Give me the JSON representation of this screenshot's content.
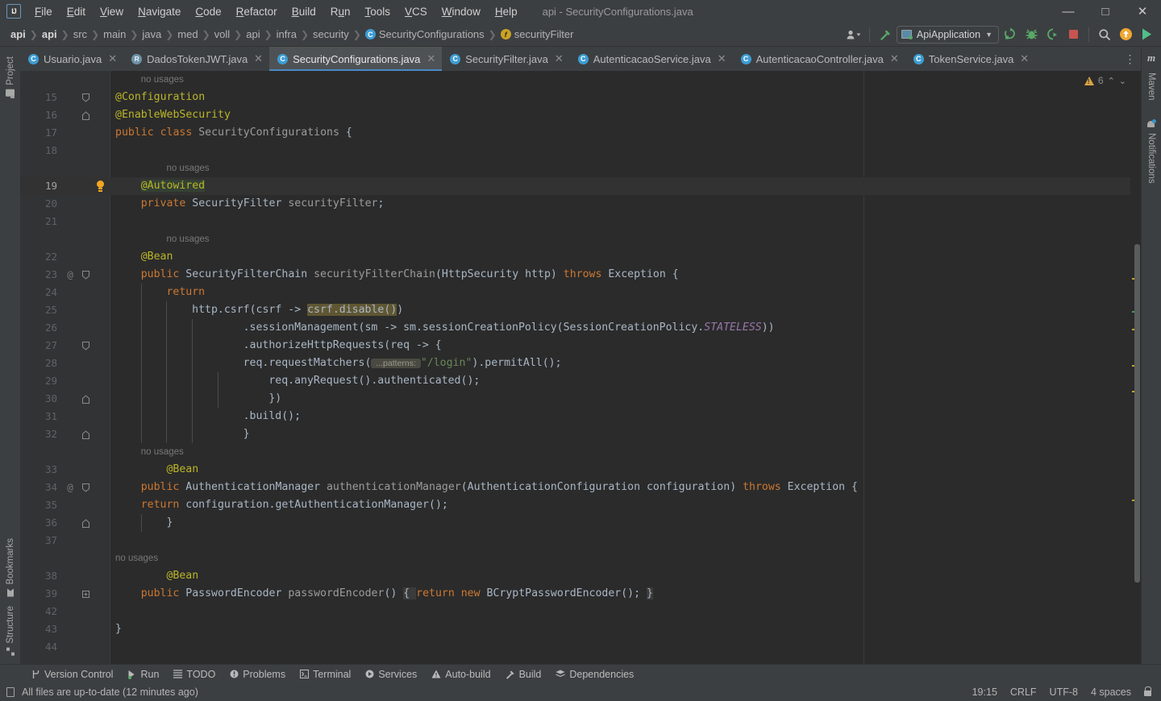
{
  "window": {
    "title": "api - SecurityConfigurations.java",
    "app_icon": "intellij-logo-icon",
    "minimize": "—",
    "maximize": "□",
    "close": "✕"
  },
  "menubar": [
    {
      "label": "File"
    },
    {
      "label": "Edit"
    },
    {
      "label": "View"
    },
    {
      "label": "Navigate"
    },
    {
      "label": "Code"
    },
    {
      "label": "Refactor"
    },
    {
      "label": "Build"
    },
    {
      "label": "Run"
    },
    {
      "label": "Tools"
    },
    {
      "label": "VCS"
    },
    {
      "label": "Window"
    },
    {
      "label": "Help"
    }
  ],
  "breadcrumbs": [
    {
      "label": "api",
      "icon": "",
      "bold": true
    },
    {
      "label": "api",
      "icon": "",
      "bold": true
    },
    {
      "label": "src",
      "icon": ""
    },
    {
      "label": "main",
      "icon": ""
    },
    {
      "label": "java",
      "icon": ""
    },
    {
      "label": "med",
      "icon": ""
    },
    {
      "label": "voll",
      "icon": ""
    },
    {
      "label": "api",
      "icon": ""
    },
    {
      "label": "infra",
      "icon": ""
    },
    {
      "label": "security",
      "icon": ""
    },
    {
      "label": "SecurityConfigurations",
      "icon": "class-icon",
      "icon_glyph": "C"
    },
    {
      "label": "securityFilter",
      "icon": "field-icon",
      "icon_glyph": "f"
    }
  ],
  "toolbar": {
    "run_configuration": "ApiApplication",
    "buttons": [
      {
        "name": "user-account-icon"
      },
      {
        "name": "build-hammer-icon"
      },
      {
        "name": "run-icon"
      },
      {
        "name": "debug-icon"
      },
      {
        "name": "run-with-coverage-icon"
      },
      {
        "name": "stop-icon"
      },
      {
        "name": "search-everywhere-icon"
      },
      {
        "name": "update-project-icon"
      },
      {
        "name": "ide-assistant-icon"
      }
    ]
  },
  "left_stripe": [
    {
      "label": "Project",
      "icon": "folder-icon"
    },
    {
      "label": "Bookmarks",
      "icon": "bookmark-icon"
    },
    {
      "label": "Structure",
      "icon": "structure-icon"
    }
  ],
  "right_stripe": [
    {
      "label": "Maven",
      "icon": "maven-icon"
    },
    {
      "label": "Notifications",
      "icon": "bell-icon"
    }
  ],
  "tabs": [
    {
      "label": "Usuario.java",
      "icon": "class-icon",
      "glyph": "C",
      "active": false
    },
    {
      "label": "DadosTokenJWT.java",
      "icon": "record-icon",
      "glyph": "R",
      "active": false
    },
    {
      "label": "SecurityConfigurations.java",
      "icon": "class-icon",
      "glyph": "C",
      "active": true
    },
    {
      "label": "SecurityFilter.java",
      "icon": "class-icon",
      "glyph": "C",
      "active": false
    },
    {
      "label": "AutenticacaoService.java",
      "icon": "class-icon",
      "glyph": "C",
      "active": false
    },
    {
      "label": "AutenticacaoController.java",
      "icon": "class-icon",
      "glyph": "C",
      "active": false
    },
    {
      "label": "TokenService.java",
      "icon": "class-icon",
      "glyph": "C",
      "active": false
    }
  ],
  "inspection_widget": {
    "warning_count": "6",
    "icon": "warning-triangle-icon",
    "prev": "⌃",
    "next": "⌄"
  },
  "editor": {
    "file": "SecurityConfigurations.java",
    "lines": [
      {
        "num": "",
        "kind": "hint",
        "text": "no usages",
        "indent": 0
      },
      {
        "num": "15",
        "kind": "code",
        "fold": "collapse-top",
        "tokens": [
          {
            "t": "@Configuration",
            "c": "ann"
          }
        ]
      },
      {
        "num": "16",
        "kind": "code",
        "fold": "collapse-bottom",
        "tokens": [
          {
            "t": "@EnableWebSecurity",
            "c": "ann"
          }
        ]
      },
      {
        "num": "17",
        "kind": "code",
        "tokens": [
          {
            "t": "public ",
            "c": "kw"
          },
          {
            "t": "class ",
            "c": "kw"
          },
          {
            "t": "SecurityConfigurations ",
            "c": "decl"
          },
          {
            "t": "{",
            "c": "punc"
          }
        ]
      },
      {
        "num": "18",
        "kind": "code",
        "tokens": []
      },
      {
        "num": "",
        "kind": "hint",
        "text": "no usages",
        "indent": 1
      },
      {
        "num": "19",
        "kind": "code",
        "bulb": true,
        "highlight": true,
        "tokens": [
          {
            "t": "@Autowired",
            "c": "ann sel"
          }
        ]
      },
      {
        "num": "20",
        "kind": "code",
        "tokens": [
          {
            "t": "private ",
            "c": "kw"
          },
          {
            "t": "SecurityFilter ",
            "c": "cls"
          },
          {
            "t": "securityFilter",
            "c": "decl"
          },
          {
            "t": ";",
            "c": "punc"
          }
        ]
      },
      {
        "num": "21",
        "kind": "code",
        "tokens": []
      },
      {
        "num": "",
        "kind": "hint",
        "text": "no usages",
        "indent": 1
      },
      {
        "num": "22",
        "kind": "code",
        "tokens": [
          {
            "t": "@Bean",
            "c": "ann"
          }
        ]
      },
      {
        "num": "23",
        "kind": "code",
        "annot": "@",
        "fold": "collapse-top",
        "tokens": [
          {
            "t": "public ",
            "c": "kw"
          },
          {
            "t": "SecurityFilterChain ",
            "c": "cls"
          },
          {
            "t": "securityFilterChain",
            "c": "decl"
          },
          {
            "t": "(",
            "c": "punc"
          },
          {
            "t": "HttpSecurity http",
            "c": "cls"
          },
          {
            "t": ") ",
            "c": "punc"
          },
          {
            "t": "throws ",
            "c": "kw"
          },
          {
            "t": "Exception {",
            "c": "cls"
          }
        ]
      },
      {
        "num": "24",
        "kind": "code",
        "tokens": [
          {
            "t": "return",
            "c": "kw"
          }
        ]
      },
      {
        "num": "25",
        "kind": "code",
        "tokens": [
          {
            "t": "http.csrf(csrf -> ",
            "c": "punc"
          },
          {
            "t": "csrf.disable()",
            "c": "occ"
          },
          {
            "t": ")",
            "c": "punc"
          }
        ]
      },
      {
        "num": "26",
        "kind": "code",
        "tokens": [
          {
            "t": ".sessionManagement(sm -> sm.sessionCreationPolicy(SessionCreationPolicy.",
            "c": "punc"
          },
          {
            "t": "STATELESS",
            "c": "stat"
          },
          {
            "t": "))",
            "c": "punc"
          }
        ]
      },
      {
        "num": "27",
        "kind": "code",
        "fold": "collapse-top",
        "tokens": [
          {
            "t": ".authorizeHttpRequests(req -> {",
            "c": "punc"
          }
        ]
      },
      {
        "num": "28",
        "kind": "code",
        "tokens": [
          {
            "t": "req.requestMatchers(",
            "c": "punc"
          },
          {
            "t": " ...patterns: ",
            "c": "inlay"
          },
          {
            "t": "\"/login\"",
            "c": "str"
          },
          {
            "t": ").permitAll();",
            "c": "punc"
          }
        ]
      },
      {
        "num": "29",
        "kind": "code",
        "tokens": [
          {
            "t": "req.anyRequest().authenticated();",
            "c": "punc"
          }
        ]
      },
      {
        "num": "30",
        "kind": "code",
        "fold": "collapse-bottom",
        "tokens": [
          {
            "t": "})",
            "c": "punc"
          }
        ]
      },
      {
        "num": "31",
        "kind": "code",
        "tokens": [
          {
            "t": ".build();",
            "c": "punc"
          }
        ]
      },
      {
        "num": "32",
        "kind": "code",
        "fold": "collapse-bottom",
        "tokens": [
          {
            "t": "}",
            "c": "punc"
          }
        ]
      },
      {
        "num": "",
        "kind": "hint",
        "text": "no usages",
        "indent": 1
      },
      {
        "num": "33",
        "kind": "code",
        "tokens": [
          {
            "t": "@Bean",
            "c": "ann"
          }
        ]
      },
      {
        "num": "34",
        "kind": "code",
        "annot": "@",
        "fold": "collapse-top",
        "tokens": [
          {
            "t": "public ",
            "c": "kw"
          },
          {
            "t": "AuthenticationManager ",
            "c": "cls"
          },
          {
            "t": "authenticationManager",
            "c": "decl"
          },
          {
            "t": "(",
            "c": "punc"
          },
          {
            "t": "AuthenticationConfiguration configuration",
            "c": "cls"
          },
          {
            "t": ") ",
            "c": "punc"
          },
          {
            "t": "throws ",
            "c": "kw"
          },
          {
            "t": "Exception {",
            "c": "cls"
          }
        ]
      },
      {
        "num": "35",
        "kind": "code",
        "tokens": [
          {
            "t": "return ",
            "c": "kw"
          },
          {
            "t": "configuration.getAuthenticationManager();",
            "c": "punc"
          }
        ]
      },
      {
        "num": "36",
        "kind": "code",
        "fold": "collapse-bottom",
        "tokens": [
          {
            "t": "}",
            "c": "punc"
          }
        ]
      },
      {
        "num": "37",
        "kind": "code",
        "tokens": []
      },
      {
        "num": "",
        "kind": "hint",
        "text": "no usages",
        "indent": 1
      },
      {
        "num": "38",
        "kind": "code",
        "tokens": [
          {
            "t": "@Bean",
            "c": "ann"
          }
        ]
      },
      {
        "num": "39",
        "kind": "code",
        "fold": "expand",
        "tokens": [
          {
            "t": "public ",
            "c": "kw"
          },
          {
            "t": "PasswordEncoder ",
            "c": "cls"
          },
          {
            "t": "passwordEncoder",
            "c": "decl"
          },
          {
            "t": "() ",
            "c": "punc"
          },
          {
            "t": "{ ",
            "c": "foldbg"
          },
          {
            "t": "return ",
            "c": "kw"
          },
          {
            "t": "new ",
            "c": "kw"
          },
          {
            "t": "BCryptPasswordEncoder(); ",
            "c": "punc"
          },
          {
            "t": "}",
            "c": "foldbg"
          }
        ]
      },
      {
        "num": "42",
        "kind": "code",
        "tokens": []
      },
      {
        "num": "43",
        "kind": "code",
        "tokens": [
          {
            "t": "}",
            "c": "punc"
          }
        ]
      },
      {
        "num": "44",
        "kind": "code",
        "tokens": []
      }
    ]
  },
  "bottom_bar": [
    {
      "label": "Version Control",
      "icon": "branch-icon"
    },
    {
      "label": "Run",
      "icon": "run-icon"
    },
    {
      "label": "TODO",
      "icon": "list-icon"
    },
    {
      "label": "Problems",
      "icon": "problems-icon"
    },
    {
      "label": "Terminal",
      "icon": "terminal-icon"
    },
    {
      "label": "Services",
      "icon": "services-icon"
    },
    {
      "label": "Auto-build",
      "icon": "warning-triangle-icon"
    },
    {
      "label": "Build",
      "icon": "hammer-icon"
    },
    {
      "label": "Dependencies",
      "icon": "layers-icon"
    }
  ],
  "status_bar": {
    "message": "All files are up-to-date (12 minutes ago)",
    "message_icon": "document-icon",
    "time": "19:15",
    "line_separator": "CRLF",
    "encoding": "UTF-8",
    "indent": "4 spaces",
    "lock": "lock-icon"
  },
  "colors": {
    "accent": "#4a88c7",
    "annotation": "#bbb529",
    "keyword": "#cc7832",
    "string": "#6a8759",
    "editor_bg": "#2b2b2b",
    "chrome_bg": "#3c3f41",
    "warning": "#d9a343"
  }
}
